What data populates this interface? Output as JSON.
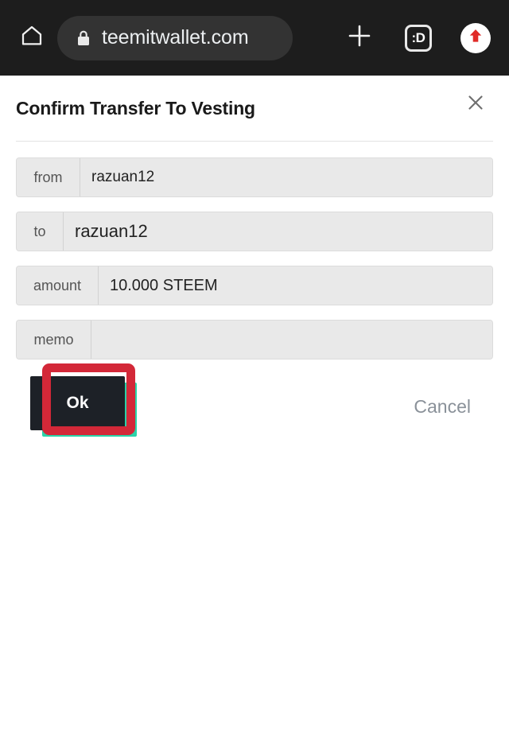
{
  "browser": {
    "home_icon": "home-icon",
    "lock_icon": "lock-icon",
    "url": "teemitwallet.com",
    "new_tab_icon": "plus-icon",
    "tab_count": ":D",
    "upload_icon": "upload-arrow-icon"
  },
  "dialog": {
    "title": "Confirm Transfer To Vesting",
    "close_icon": "close-icon",
    "fields": [
      {
        "label": "from",
        "value": "razuan12"
      },
      {
        "label": "to",
        "value": "razuan12"
      },
      {
        "label": "amount",
        "value": "10.000 STEEM"
      },
      {
        "label": "memo",
        "value": ""
      }
    ],
    "ok_label": "Ok",
    "cancel_label": "Cancel"
  },
  "annotation": {
    "highlight_color": "#d32838",
    "shadow_color": "#2ad3a8",
    "target": "ok-button"
  }
}
